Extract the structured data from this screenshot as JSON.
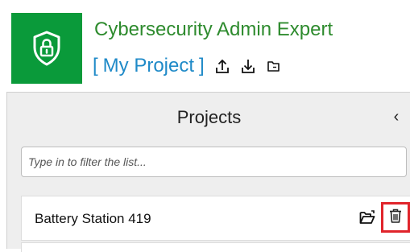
{
  "header": {
    "app_title": "Cybersecurity Admin Expert",
    "bracket_open": "[",
    "project_name": "My Project",
    "bracket_close": "]",
    "icons": [
      "upload-icon",
      "download-icon",
      "folder-icon"
    ]
  },
  "logo": {
    "icon": "shield-lock-icon",
    "color": "#0a9a3a"
  },
  "sidebar": {
    "title": "Projects",
    "collapse_glyph": "‹",
    "filter": {
      "placeholder": "Type in to filter the list...",
      "value": ""
    },
    "projects": [
      {
        "name": "Battery Station 419",
        "actions": [
          "open-folder-icon",
          "trash-icon"
        ]
      }
    ]
  },
  "colors": {
    "brand_green": "#0a9a3a",
    "title_green": "#2e8b2e",
    "link_blue": "#1f8ac8",
    "highlight_red": "#e0242b"
  }
}
